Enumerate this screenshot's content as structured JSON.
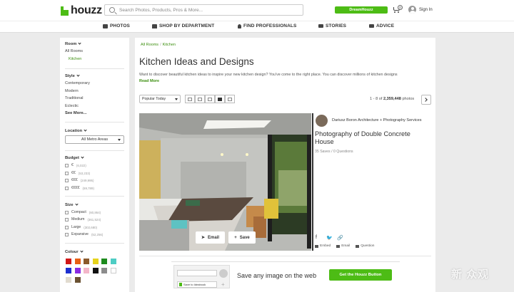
{
  "header": {
    "logo_text": "houzz",
    "search_placeholder": "Search Photos, Products, Pros & More...",
    "cta_label": "DreamHouzz",
    "cart_count": "0",
    "signin_label": "Sign In"
  },
  "nav": {
    "items": [
      {
        "label": "PHOTOS",
        "icon": "photo-icon"
      },
      {
        "label": "SHOP BY DEPARTMENT",
        "icon": "store-icon"
      },
      {
        "label": "FIND PROFESSIONALS",
        "icon": "person-icon"
      },
      {
        "label": "STORIES",
        "icon": "book-icon"
      },
      {
        "label": "ADVICE",
        "icon": "chat-icon"
      }
    ]
  },
  "sidebar": {
    "room_heading": "Room",
    "room_items": [
      "All Rooms",
      "Kitchen"
    ],
    "style_heading": "Style",
    "style_items": [
      "Contemporary",
      "Modern",
      "Traditional",
      "Eclectic"
    ],
    "style_more": "See More...",
    "location_heading": "Location",
    "location_value": "All Metro Areas",
    "budget_heading": "Budget",
    "budget_items": [
      {
        "label": "€",
        "count": "(6,022)"
      },
      {
        "label": "€€",
        "count": "(53,233)"
      },
      {
        "label": "€€€",
        "count": "(249,995)"
      },
      {
        "label": "€€€€",
        "count": "(69,789)"
      }
    ],
    "size_heading": "Size",
    "size_items": [
      {
        "label": "Compact",
        "count": "(60,864)"
      },
      {
        "label": "Medium",
        "count": "(361,524)"
      },
      {
        "label": "Large",
        "count": "(302,680)"
      },
      {
        "label": "Expansive",
        "count": "(52,256)"
      }
    ],
    "colour_heading": "Colour",
    "swatches": [
      "#d01717",
      "#e85f14",
      "#8b5a2b",
      "#e6d31c",
      "#1d8b1d",
      "#4ecdc4",
      "#1d2fd0",
      "#8a2be2",
      "#f3b6c9",
      "#111111",
      "#8c8c8c",
      "#ffffff",
      "#e1dbcf",
      "#6b5233"
    ]
  },
  "main": {
    "breadcrumb": [
      "All Rooms",
      "Kitchen"
    ],
    "title": "Kitchen Ideas and Designs",
    "description": "Want to discover beautiful kitchen ideas to inspire your new kitchen design? You've come to the right place. You can discover millions of kitchen designs",
    "read_more": "Read More",
    "sort_label": "Popular Today",
    "counter_prefix": "1 - 8 of",
    "counter_total": "2,359,448",
    "counter_suffix": "photos"
  },
  "photo": {
    "email_label": "Email",
    "save_label": "Save",
    "pro_name": "Dariusz Boron Architecture + Photography Services",
    "title": "Photography of Double Concrete House",
    "stats": "35 Saves / 0 Questions",
    "actions": [
      "Embed",
      "Email",
      "Question"
    ]
  },
  "promo": {
    "mock_label": "Save to Ideabook",
    "text": "Save any image on the web",
    "button_label": "Get the Houzz Button"
  },
  "watermark": "新 众观"
}
